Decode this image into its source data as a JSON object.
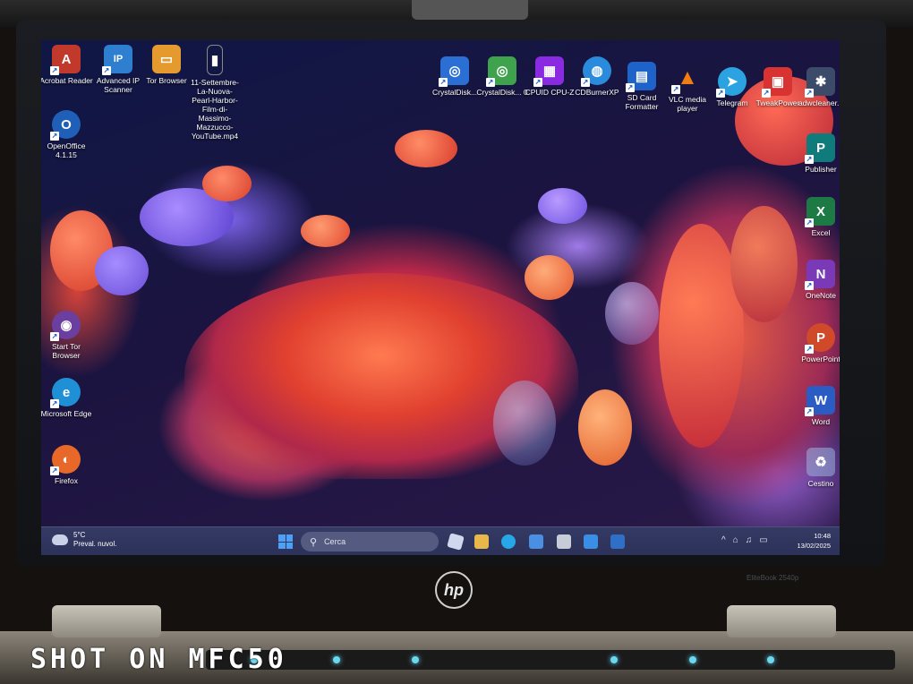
{
  "desktop": {
    "left_icons": [
      {
        "label": "Acrobat Reader",
        "icon": "acrobat-icon",
        "color": "#c0392b",
        "glyph": "A"
      },
      {
        "label": "Advanced IP Scanner",
        "icon": "network-scanner-icon",
        "color": "#2f7fd1",
        "glyph": "IP"
      },
      {
        "label": "Tor Browser",
        "icon": "folder-icon",
        "color": "#e59a2f",
        "glyph": "▭"
      },
      {
        "label": "11-Settembre-La-Nuova-Pearl-Harbor-Film-di-Massimo-Mazzucco-YouTube.mp4",
        "icon": "video-file-icon",
        "color": "#555a66",
        "glyph": "▮"
      },
      {
        "label": "OpenOffice 4.1.15",
        "icon": "openoffice-icon",
        "color": "#1f5fb8",
        "glyph": "O"
      }
    ],
    "left_column": [
      {
        "label": "Start Tor Browser",
        "icon": "tor-icon",
        "color": "#6b3fa0",
        "glyph": "◉"
      },
      {
        "label": "Microsoft Edge",
        "icon": "edge-icon",
        "color": "#1f8fd6",
        "glyph": "e"
      },
      {
        "label": "Firefox",
        "icon": "firefox-icon",
        "color": "#e8682a",
        "glyph": "◐"
      }
    ],
    "top_right_icons": [
      {
        "label": "CrystalDisk...",
        "icon": "crystaldisk-icon",
        "color": "#2b6fd4",
        "glyph": "◎"
      },
      {
        "label": "CrystalDisk... 0",
        "icon": "crystaldisk-mark-icon",
        "color": "#3fa34d",
        "glyph": "◎"
      },
      {
        "label": "CPUID CPU-Z",
        "icon": "cpuz-icon",
        "color": "#8a2be2",
        "glyph": "▦"
      },
      {
        "label": "CDBurnerXP",
        "icon": "cdburner-icon",
        "color": "#2a8adb",
        "glyph": "◍"
      },
      {
        "label": "SD Card Formatter",
        "icon": "sd-card-icon",
        "color": "#1d63c9",
        "glyph": "▤"
      },
      {
        "label": "VLC media player",
        "icon": "vlc-icon",
        "color": "#f07d12",
        "glyph": "▲"
      },
      {
        "label": "Telegram",
        "icon": "telegram-icon",
        "color": "#2aa3e0",
        "glyph": "➤"
      },
      {
        "label": "TweakPower",
        "icon": "tweakpower-icon",
        "color": "#d93232",
        "glyph": "▣"
      },
      {
        "label": "adwcleaner...",
        "icon": "adwcleaner-icon",
        "color": "#3d4b6b",
        "glyph": "✱"
      }
    ],
    "right_column": [
      {
        "label": "Publisher",
        "icon": "publisher-icon",
        "color": "#0f7b7b",
        "glyph": "P"
      },
      {
        "label": "Excel",
        "icon": "excel-icon",
        "color": "#1e7a45",
        "glyph": "X"
      },
      {
        "label": "OneNote",
        "icon": "onenote-icon",
        "color": "#7a3ab8",
        "glyph": "N"
      },
      {
        "label": "PowerPoint",
        "icon": "powerpoint-icon",
        "color": "#d04a2a",
        "glyph": "P"
      },
      {
        "label": "Word",
        "icon": "word-icon",
        "color": "#2b5cc4",
        "glyph": "W"
      },
      {
        "label": "Cestino",
        "icon": "recycle-bin-icon",
        "color": "#6f8fb8",
        "glyph": "♻"
      }
    ]
  },
  "taskbar": {
    "weather_temp": "5°C",
    "weather_desc": "Preval. nuvol.",
    "search_placeholder": "Cerca",
    "apps": [
      {
        "icon": "copilot-icon",
        "color": "#d0d8ef"
      },
      {
        "icon": "file-explorer-icon",
        "color": "#e8b84a"
      },
      {
        "icon": "edge-taskbar-icon",
        "color": "#27a6e8"
      },
      {
        "icon": "mail-icon",
        "color": "#4a90e2"
      },
      {
        "icon": "printer-icon",
        "color": "#c8ccd8"
      },
      {
        "icon": "store-icon",
        "color": "#3a8ee6"
      },
      {
        "icon": "photos-icon",
        "color": "#2f6fc6"
      }
    ],
    "tray": [
      "^",
      "⌂",
      "♫",
      "▭"
    ],
    "time": "10:48",
    "date": "13/02/2025"
  },
  "laptop": {
    "logo": "hp",
    "model": "EliteBook 2540p"
  },
  "watermark": "SHOT ON MFC50"
}
